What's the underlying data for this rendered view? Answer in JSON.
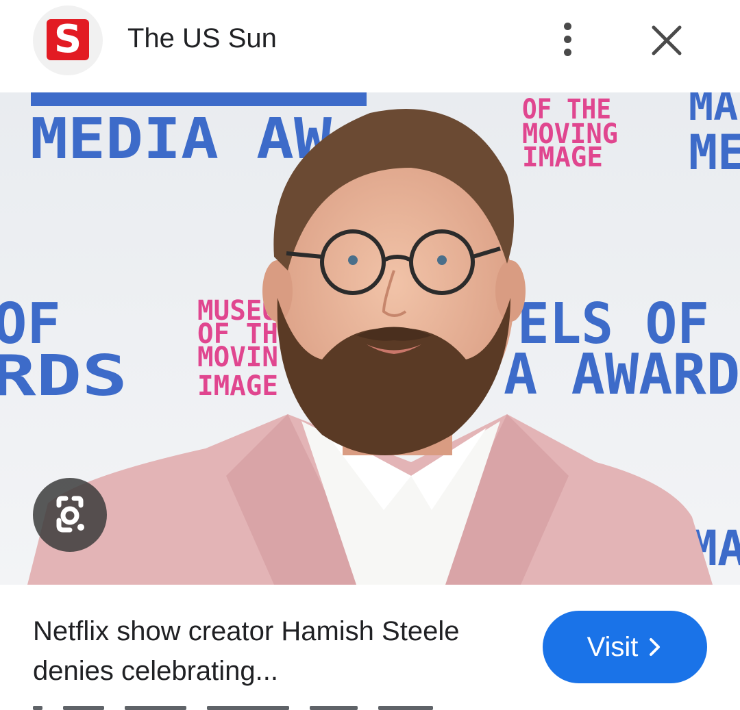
{
  "header": {
    "logo_letter": "S",
    "site_name": "The US Sun",
    "menu_icon": "more-vert-icon",
    "close_icon": "close-icon"
  },
  "image": {
    "backdrop_text": {
      "left_title": "MEDIA AW",
      "museum_lines": [
        "OF THE",
        "MOVING",
        "IMAGE"
      ],
      "museum_lines_mid": [
        "MUSEU",
        "OF TH",
        "MOVIN",
        "IMAGE"
      ],
      "mid_left": [
        "OF",
        "RDS"
      ],
      "mid_right": [
        "ELS OF",
        "A AWARD"
      ],
      "right_edge": [
        "MA",
        "ME"
      ],
      "bottom_right": "MA"
    },
    "lens_icon": "google-lens-icon"
  },
  "article": {
    "headline": "Netflix show creator Hamish Steele denies celebrating..."
  },
  "visit_button": {
    "label": "Visit",
    "icon": "chevron-right-icon"
  },
  "colors": {
    "brand_red": "#e21b23",
    "accent_blue": "#1a73e8",
    "backdrop_blue": "#3d6bc9",
    "backdrop_pink": "#e0468f",
    "jacket_pink": "#e3b4b6"
  }
}
